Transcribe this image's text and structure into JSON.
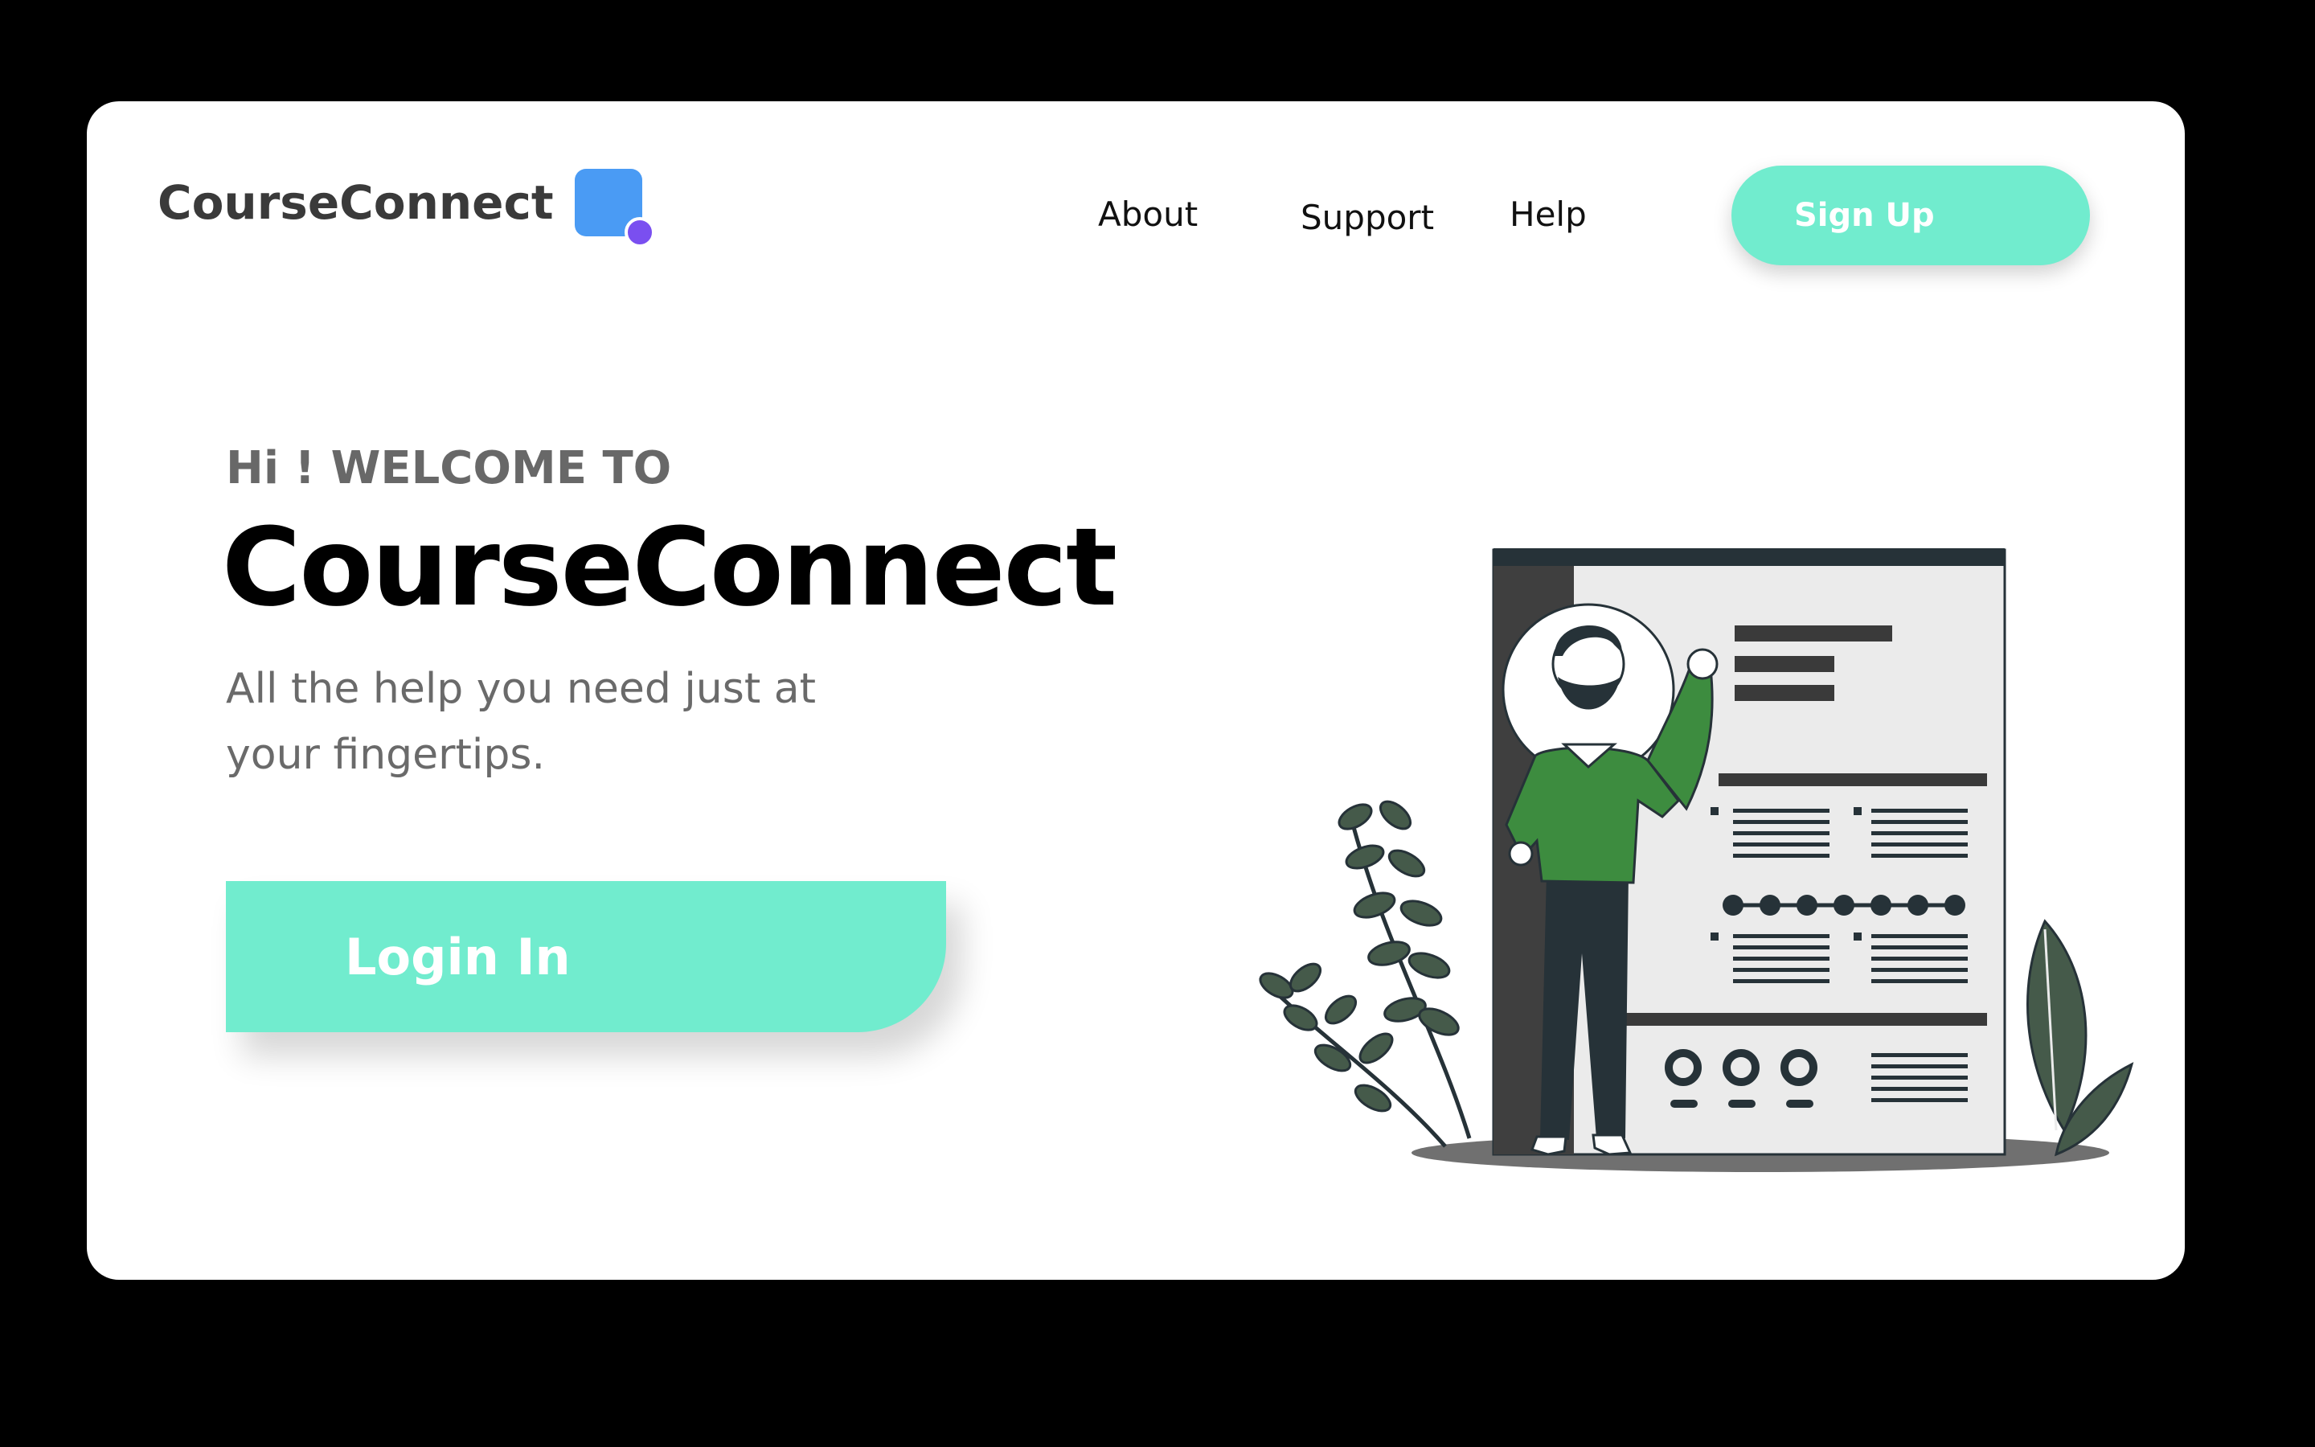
{
  "brand": {
    "name": "CourseConnect",
    "logo_icon": "rounded-square-logo-icon",
    "logo_color": "#4a9bf4",
    "logo_dot_color": "#7a4ff0"
  },
  "nav": {
    "about": "About",
    "support": "Support",
    "help": "Help",
    "signup_label": "Sign Up"
  },
  "hero": {
    "eyebrow": "Hi ! WELCOME TO",
    "title": "CourseConnect",
    "subtitle": "All the help you need just at your fingertips.",
    "login_label": "Login In"
  },
  "illustration": {
    "icon": "man-with-resume-illustration-icon"
  },
  "colors": {
    "accent": "#71ecce",
    "background": "#000000",
    "card": "#ffffff",
    "illustration_green": "#3d8c3f",
    "illustration_dark": "#263238"
  }
}
